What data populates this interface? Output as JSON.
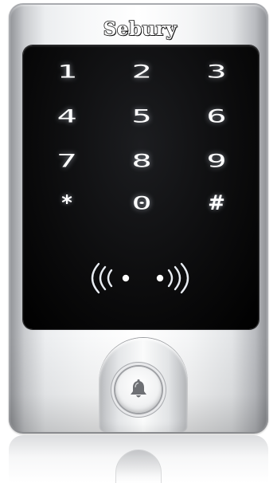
{
  "device": {
    "brand": "Sebury",
    "keypad": {
      "rows": [
        [
          "1",
          "2",
          "3"
        ],
        [
          "4",
          "5",
          "6"
        ],
        [
          "7",
          "8",
          "9"
        ],
        [
          "*",
          "0",
          "#"
        ]
      ]
    },
    "rfid_icon": "rfid-wave-icon",
    "doorbell_icon": "bell-icon"
  },
  "colors": {
    "panel": "#000000",
    "key_glow": "#ffffff",
    "casing": "#e9eaec"
  }
}
